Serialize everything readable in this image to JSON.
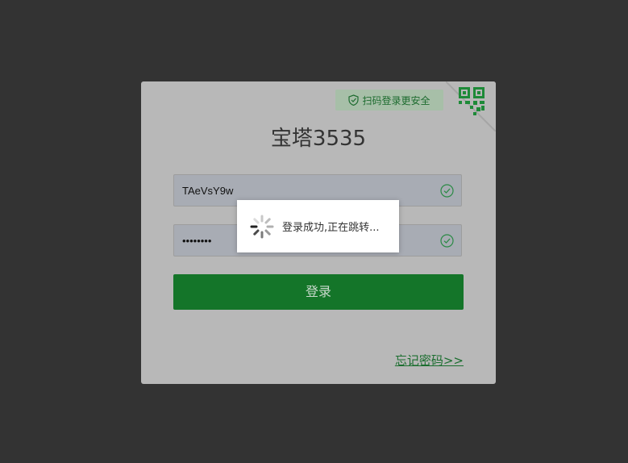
{
  "login": {
    "qr_tip": "扫码登录更安全",
    "brand_title": "宝塔3535",
    "username_value": "TAeVsY9w",
    "password_value": "••••••••",
    "login_button": "登录",
    "forgot_link": "忘记密码>>"
  },
  "toast": {
    "message": "登录成功,正在跳转..."
  },
  "icons": {
    "qr": "qr-code-icon",
    "shield": "shield-check-icon",
    "field_check": "check-circle-icon",
    "spinner": "loading-spinner-icon"
  },
  "colors": {
    "backdrop": "#333333",
    "card": "#b8b8b8",
    "accent": "#147529",
    "link": "#1b6e2f"
  }
}
